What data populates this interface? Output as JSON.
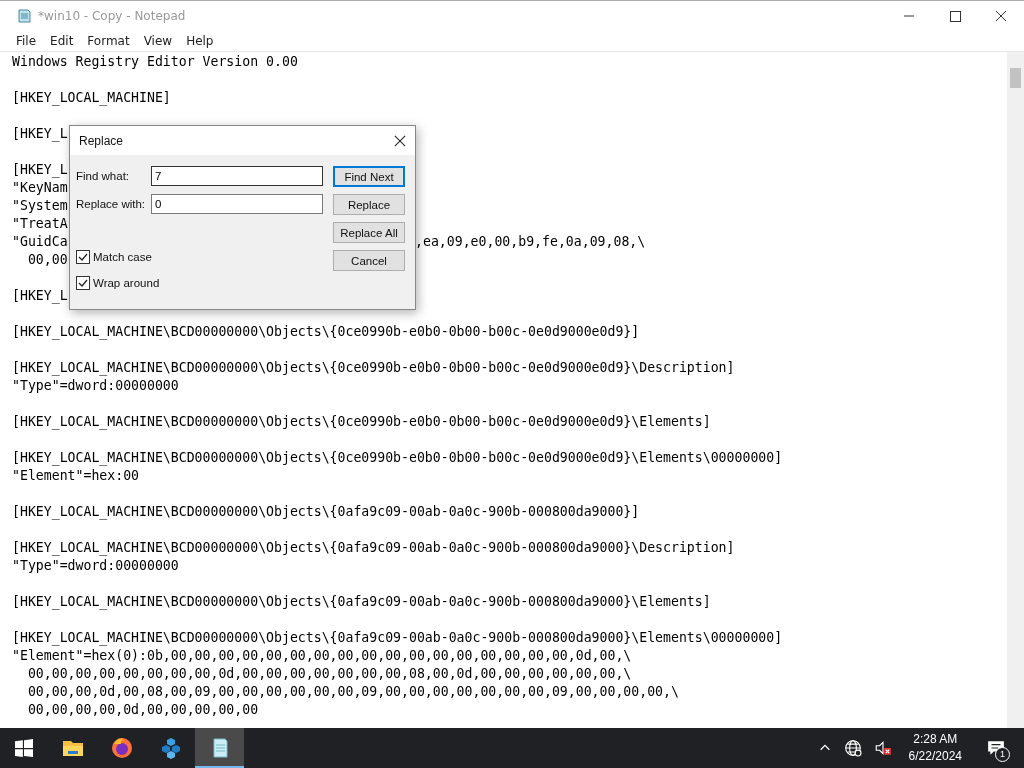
{
  "window": {
    "title": "*win10 - Copy - Notepad"
  },
  "menu": [
    {
      "label": "File"
    },
    {
      "label": "Edit"
    },
    {
      "label": "Format"
    },
    {
      "label": "View"
    },
    {
      "label": "Help"
    }
  ],
  "editor": {
    "blocks": [
      [
        {
          "text": "Windows Registry Editor Version 0.00"
        }
      ],
      [
        {
          "text": "[HKEY_LOCAL_MACHINE]"
        }
      ],
      [
        {
          "text": "[HKEY_L"
        }
      ],
      [
        {
          "text": "[HKEY_L"
        },
        {
          "text": "\"KeyNam"
        },
        {
          "text": "\"System"
        },
        {
          "text": "\"TreatA"
        },
        {
          "text": "\"GuidCa",
          "right": ",ea,09,e0,00,b9,fe,0a,09,08,\\"
        },
        {
          "text": "  00,00"
        }
      ],
      [
        {
          "text": "[HKEY_L"
        }
      ],
      [
        {
          "text": "[HKEY_LOCAL_MACHINE\\BCD00000000\\Objects\\{0ce0990b-e0b0-0b00-b00c-0e0d9000e0d9}]"
        }
      ],
      [
        {
          "text": "[HKEY_LOCAL_MACHINE\\BCD00000000\\Objects\\{0ce0990b-e0b0-0b00-b00c-0e0d9000e0d9}\\Description]"
        },
        {
          "text": "\"Type\"=dword:00000000"
        }
      ],
      [
        {
          "text": "[HKEY_LOCAL_MACHINE\\BCD00000000\\Objects\\{0ce0990b-e0b0-0b00-b00c-0e0d9000e0d9}\\Elements]"
        }
      ],
      [
        {
          "text": "[HKEY_LOCAL_MACHINE\\BCD00000000\\Objects\\{0ce0990b-e0b0-0b00-b00c-0e0d9000e0d9}\\Elements\\00000000]"
        },
        {
          "text": "\"Element\"=hex:00"
        }
      ],
      [
        {
          "text": "[HKEY_LOCAL_MACHINE\\BCD00000000\\Objects\\{0afa9c09-00ab-0a0c-900b-000800da9000}]"
        }
      ],
      [
        {
          "text": "[HKEY_LOCAL_MACHINE\\BCD00000000\\Objects\\{0afa9c09-00ab-0a0c-900b-000800da9000}\\Description]"
        },
        {
          "text": "\"Type\"=dword:00000000"
        }
      ],
      [
        {
          "text": "[HKEY_LOCAL_MACHINE\\BCD00000000\\Objects\\{0afa9c09-00ab-0a0c-900b-000800da9000}\\Elements]"
        }
      ],
      [
        {
          "text": "[HKEY_LOCAL_MACHINE\\BCD00000000\\Objects\\{0afa9c09-00ab-0a0c-900b-000800da9000}\\Elements\\00000000]"
        },
        {
          "text": "\"Element\"=hex(0):0b,00,00,00,00,00,00,00,00,00,00,00,00,00,00,00,00,00,0d,00,\\"
        },
        {
          "text": "  00,00,00,00,00,00,00,00,0d,00,00,00,00,00,00,00,08,00,0d,00,00,00,00,00,00,\\"
        },
        {
          "text": "  00,00,00,0d,00,08,00,09,00,00,00,00,00,00,09,00,00,00,00,00,00,00,09,00,00,00,00,\\"
        },
        {
          "text": "  00,00,00,00,0d,00,00,00,00,00"
        }
      ]
    ]
  },
  "dialog": {
    "title": "Replace",
    "fields": [
      {
        "label": "Find what:",
        "value": "7"
      },
      {
        "label": "Replace with:",
        "value": "0"
      }
    ],
    "buttons": [
      {
        "label": "Find Next",
        "default": true
      },
      {
        "label": "Replace",
        "default": false
      },
      {
        "label": "Replace All",
        "default": false
      },
      {
        "label": "Cancel",
        "default": false
      }
    ],
    "options": [
      {
        "label": "Match case",
        "checked": true
      },
      {
        "label": "Wrap around",
        "checked": true
      }
    ]
  },
  "taskbar": {
    "apps": [
      {
        "kind": "explorer",
        "selected": false
      },
      {
        "kind": "firefox",
        "selected": false
      },
      {
        "kind": "cubes",
        "selected": false
      },
      {
        "kind": "notepad",
        "selected": true
      }
    ],
    "time": "2:28 AM",
    "date": "6/22/2024",
    "notifications": "1"
  }
}
